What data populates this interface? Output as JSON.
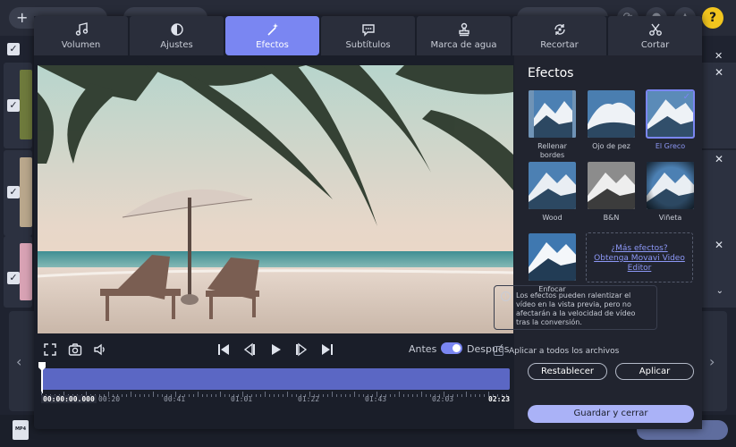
{
  "tabs": [
    {
      "label": "Volumen",
      "icon": "music-note-icon"
    },
    {
      "label": "Ajustes",
      "icon": "contrast-icon"
    },
    {
      "label": "Efectos",
      "icon": "magic-wand-icon",
      "active": true
    },
    {
      "label": "Subtítulos",
      "icon": "speech-bubble-icon"
    },
    {
      "label": "Marca de agua",
      "icon": "stamp-icon"
    },
    {
      "label": "Recortar",
      "icon": "crop-rotate-icon"
    },
    {
      "label": "Cortar",
      "icon": "scissors-icon"
    }
  ],
  "player": {
    "antes": "Antes",
    "despues": "Después",
    "compare_toggle_on": true,
    "current_time": "00:00:00.000",
    "end_time": "02:23",
    "timestamps": [
      "00:20",
      "00:41",
      "01:01",
      "01:22",
      "01:43",
      "02:03"
    ]
  },
  "effects_panel": {
    "title": "Efectos",
    "effects": [
      {
        "label": "Rellenar bordes",
        "selected": false
      },
      {
        "label": "Ojo de pez",
        "selected": false
      },
      {
        "label": "El Greco",
        "selected": true
      },
      {
        "label": "Wood",
        "selected": false
      },
      {
        "label": "B&N",
        "selected": false
      },
      {
        "label": "Viñeta",
        "selected": false
      },
      {
        "label": "Enfocar",
        "selected": false
      }
    ],
    "more_effects_line1": "¿Más efectos?",
    "more_effects_line2": "Obtenga Movavi Video Editor",
    "notice": "Los efectos pueden ralentizar el vídeo en la vista previa, pero no afectarán a la velocidad de vídeo tras la conversión.",
    "apply_all_label": "Aplicar a todos los archivos",
    "apply_all_checked": false,
    "reset_label": "Restablecer",
    "apply_label": "Aplicar",
    "save_close_label": "Guardar y cerrar"
  },
  "colors": {
    "accent": "#7a86f2",
    "dialog_bg": "#1a1e29",
    "panel_bg": "#21242f",
    "help": "#f2c51e"
  }
}
